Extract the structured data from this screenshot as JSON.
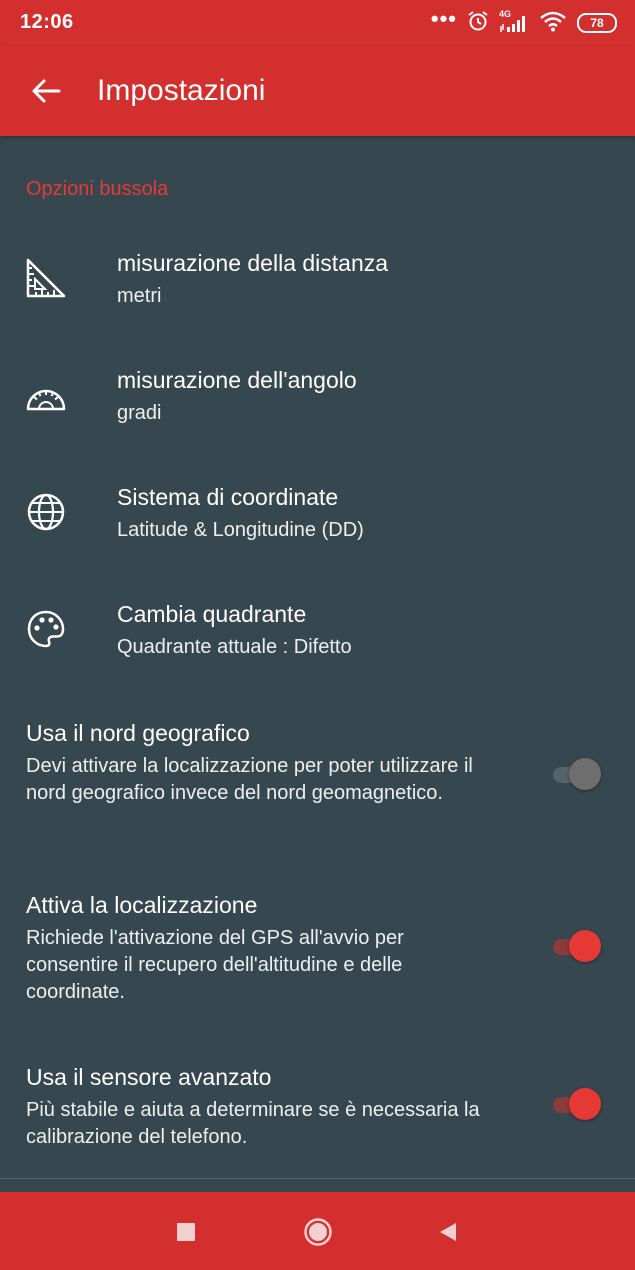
{
  "status": {
    "time": "12:06",
    "dots": "•••",
    "network": "4G",
    "battery": "78",
    "icons": [
      "more-dots-icon",
      "alarm-icon",
      "signal-icon",
      "wifi-icon",
      "battery-icon"
    ]
  },
  "appbar": {
    "title": "Impostazioni",
    "back_icon": "arrow-back-icon"
  },
  "section": {
    "header": "Opzioni bussola"
  },
  "prefs": [
    {
      "title": "misurazione della distanza",
      "summary": "metri",
      "icon": "set-square-icon"
    },
    {
      "title": "misurazione dell'angolo",
      "summary": "gradi",
      "icon": "protractor-icon"
    },
    {
      "title": "Sistema di coordinate",
      "summary": "Latitude & Longitudine (DD)",
      "icon": "globe-icon"
    },
    {
      "title": "Cambia quadrante",
      "summary": "Quadrante attuale : Difetto",
      "icon": "palette-icon"
    }
  ],
  "switches": [
    {
      "title": "Usa il nord geografico",
      "summary": "Devi attivare la localizzazione per poter utilizzare il nord geografico invece del nord geomagnetico.",
      "checked": false
    },
    {
      "title": "Attiva la localizzazione",
      "summary": "Richiede l'attivazione del GPS all'avvio per consentire il recupero dell'altitudine e delle coordinate.",
      "checked": true
    },
    {
      "title": "Usa il sensore avanzato",
      "summary": "Più stabile e aiuta a determinare se è necessaria la calibrazione del telefono.",
      "checked": true
    }
  ],
  "colors": {
    "accent": "#d32f2f",
    "background": "#37474f",
    "section_header": "#e53935"
  },
  "navbar": {
    "icons": [
      "recents-square-icon",
      "home-circle-icon",
      "back-triangle-icon"
    ]
  }
}
